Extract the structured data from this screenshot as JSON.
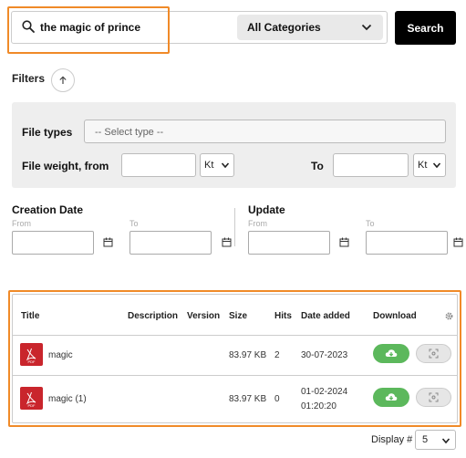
{
  "search": {
    "query": "the magic of prince",
    "category": "All Categories",
    "button": "Search"
  },
  "filters": {
    "label": "Filters",
    "file_types_label": "File types",
    "file_types_placeholder": "-- Select type --",
    "weight_from_label": "File weight, from",
    "weight_to_label": "To",
    "unit_from": "Kt",
    "unit_to": "Kt"
  },
  "dates": {
    "creation_label": "Creation Date",
    "update_label": "Update",
    "from": "From",
    "to": "To"
  },
  "table": {
    "headers": {
      "title": "Title",
      "description": "Description",
      "version": "Version",
      "size": "Size",
      "hits": "Hits",
      "date_added": "Date added",
      "download": "Download"
    },
    "rows": [
      {
        "title": "magic",
        "description": "",
        "version": "",
        "size": "83.97 KB",
        "hits": "2",
        "date_line1": "30-07-2023",
        "date_line2": ""
      },
      {
        "title": "magic (1)",
        "description": "",
        "version": "",
        "size": "83.97 KB",
        "hits": "0",
        "date_line1": "01-02-2024",
        "date_line2": "01:20:20"
      }
    ]
  },
  "pagination": {
    "display_label": "Display #",
    "display_value": "5"
  },
  "colors": {
    "highlight": "#f08a28",
    "download_green": "#5cb85c",
    "pdf_red": "#c9252c",
    "search_button": "#000000"
  }
}
